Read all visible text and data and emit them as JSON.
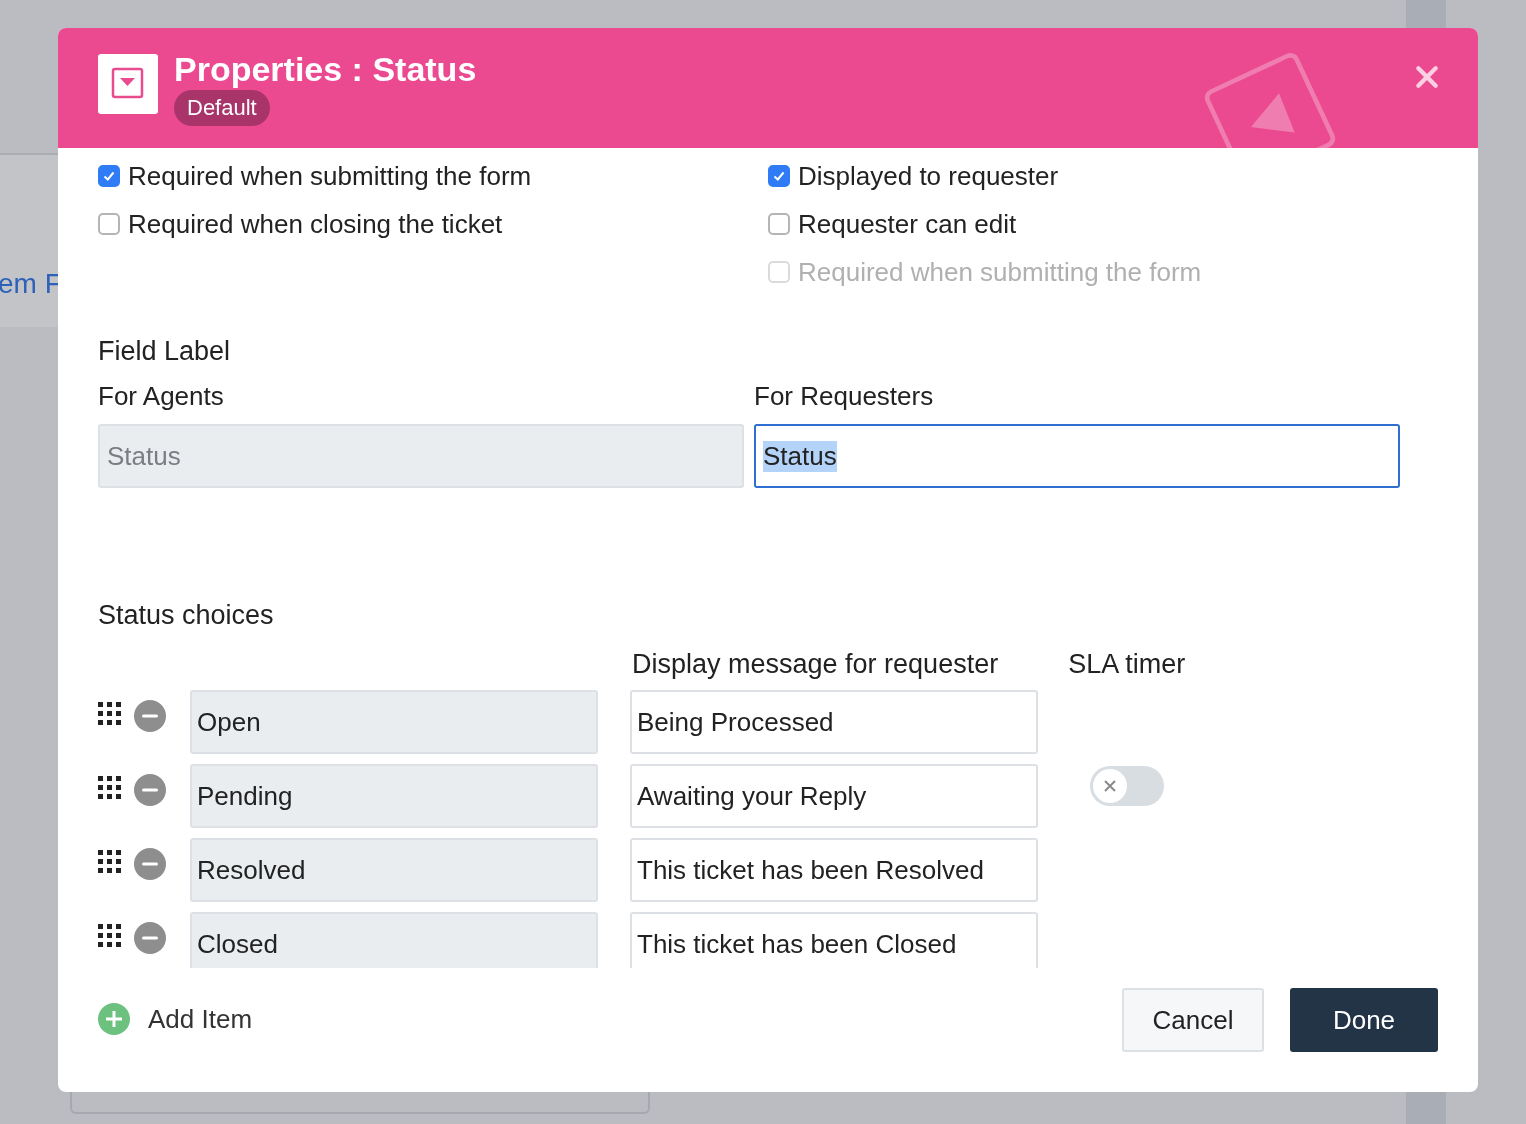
{
  "background": {
    "link_text": "em F"
  },
  "dialog": {
    "title": "Properties : Status",
    "badge": "Default",
    "option_columns": [
      [
        {
          "label": "Required when submitting the form",
          "checked": true,
          "disabled": false
        },
        {
          "label": "Required when closing the ticket",
          "checked": false,
          "disabled": false
        }
      ],
      [
        {
          "label": "Displayed to requester",
          "checked": true,
          "disabled": false
        },
        {
          "label": "Requester can edit",
          "checked": false,
          "disabled": false
        },
        {
          "label": "Required when submitting the form",
          "checked": false,
          "disabled": true
        }
      ]
    ],
    "field_label": {
      "heading": "Field Label",
      "agents_label": "For Agents",
      "agents_value": "Status",
      "requesters_label": "For Requesters",
      "requesters_value": "Status"
    },
    "choices": {
      "heading": "Status choices",
      "message_header": "Display message for requester",
      "sla_header": "SLA timer",
      "rows": [
        {
          "name": "Open",
          "message": "Being Processed"
        },
        {
          "name": "Pending",
          "message": "Awaiting your Reply",
          "sla_timer": {
            "on": false
          }
        },
        {
          "name": "Resolved",
          "message": "This ticket has been Resolved"
        },
        {
          "name": "Closed",
          "message": "This ticket has been Closed"
        }
      ]
    },
    "add_item": "Add Item",
    "buttons": [
      {
        "label": "Cancel",
        "kind": "secondary"
      },
      {
        "label": "Done",
        "kind": "primary"
      }
    ]
  }
}
